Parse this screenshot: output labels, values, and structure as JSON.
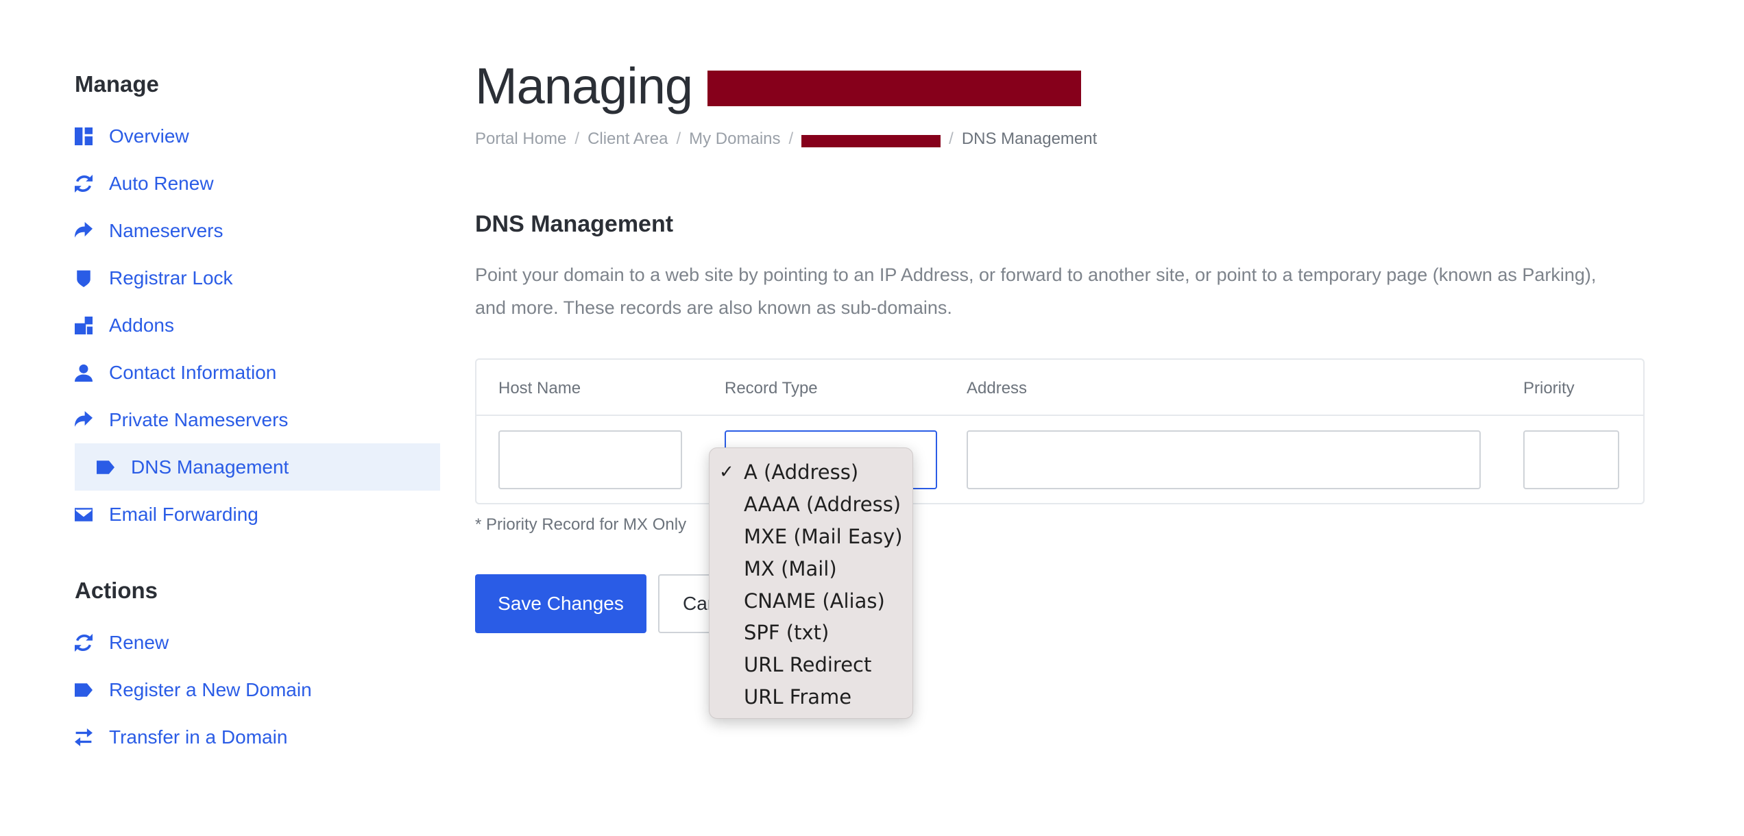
{
  "sidebar": {
    "manage_title": "Manage",
    "manage_items": [
      {
        "label": "Overview",
        "icon": "dashboard-icon"
      },
      {
        "label": "Auto Renew",
        "icon": "sync-icon"
      },
      {
        "label": "Nameservers",
        "icon": "share-arrow-icon"
      },
      {
        "label": "Registrar Lock",
        "icon": "shield-icon"
      },
      {
        "label": "Addons",
        "icon": "cubes-icon"
      },
      {
        "label": "Contact Information",
        "icon": "user-icon"
      },
      {
        "label": "Private Nameservers",
        "icon": "share-arrow-icon"
      },
      {
        "label": "DNS Management",
        "icon": "tag-icon",
        "active": true
      },
      {
        "label": "Email Forwarding",
        "icon": "envelope-icon"
      }
    ],
    "actions_title": "Actions",
    "action_items": [
      {
        "label": "Renew",
        "icon": "sync-icon"
      },
      {
        "label": "Register a New Domain",
        "icon": "tag-icon"
      },
      {
        "label": "Transfer in a Domain",
        "icon": "exchange-icon"
      }
    ]
  },
  "header": {
    "title": "Managing"
  },
  "breadcrumb": {
    "items": [
      "Portal Home",
      "Client Area",
      "My Domains"
    ],
    "separator": "/",
    "current": "DNS Management"
  },
  "main": {
    "section_title": "DNS Management",
    "description": "Point your domain to a web site by pointing to an IP Address, or forward to another site, or point to a temporary page (known as Parking), and more. These records are also known as sub-domains.",
    "table": {
      "columns": [
        "Host Name",
        "Record Type",
        "Address",
        "Priority"
      ]
    },
    "priority_note": "* Priority Record for MX Only",
    "save_label": "Save Changes",
    "cancel_label": "Cancel"
  },
  "record_type_dropdown": {
    "selected": "A (Address)",
    "options": [
      "A (Address)",
      "AAAA (Address)",
      "MXE (Mail Easy)",
      "MX (Mail)",
      "CNAME (Alias)",
      "SPF (txt)",
      "URL Redirect",
      "URL Frame"
    ]
  },
  "colors": {
    "accent": "#2a5ce6",
    "active_bg": "#eaf1fb",
    "redaction": "#86001b",
    "dropdown_bg": "#e8e3e3"
  }
}
